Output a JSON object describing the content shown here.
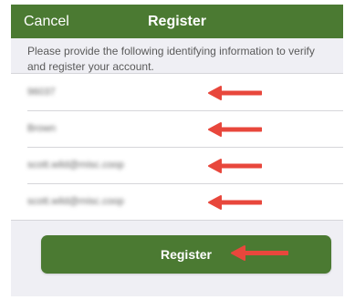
{
  "header": {
    "cancel_label": "Cancel",
    "title": "Register"
  },
  "instructions": "Please provide the following identifying information to verify and register your account.",
  "fields": [
    {
      "value": "96037"
    },
    {
      "value": "Brown"
    },
    {
      "value": "scott.wild@misc.coop"
    },
    {
      "value": "scott.wild@misc.coop"
    }
  ],
  "register_button": {
    "label": "Register"
  },
  "colors": {
    "brand_green": "#4b7a32",
    "arrow_red": "#e8473c",
    "background": "#efeff4"
  }
}
